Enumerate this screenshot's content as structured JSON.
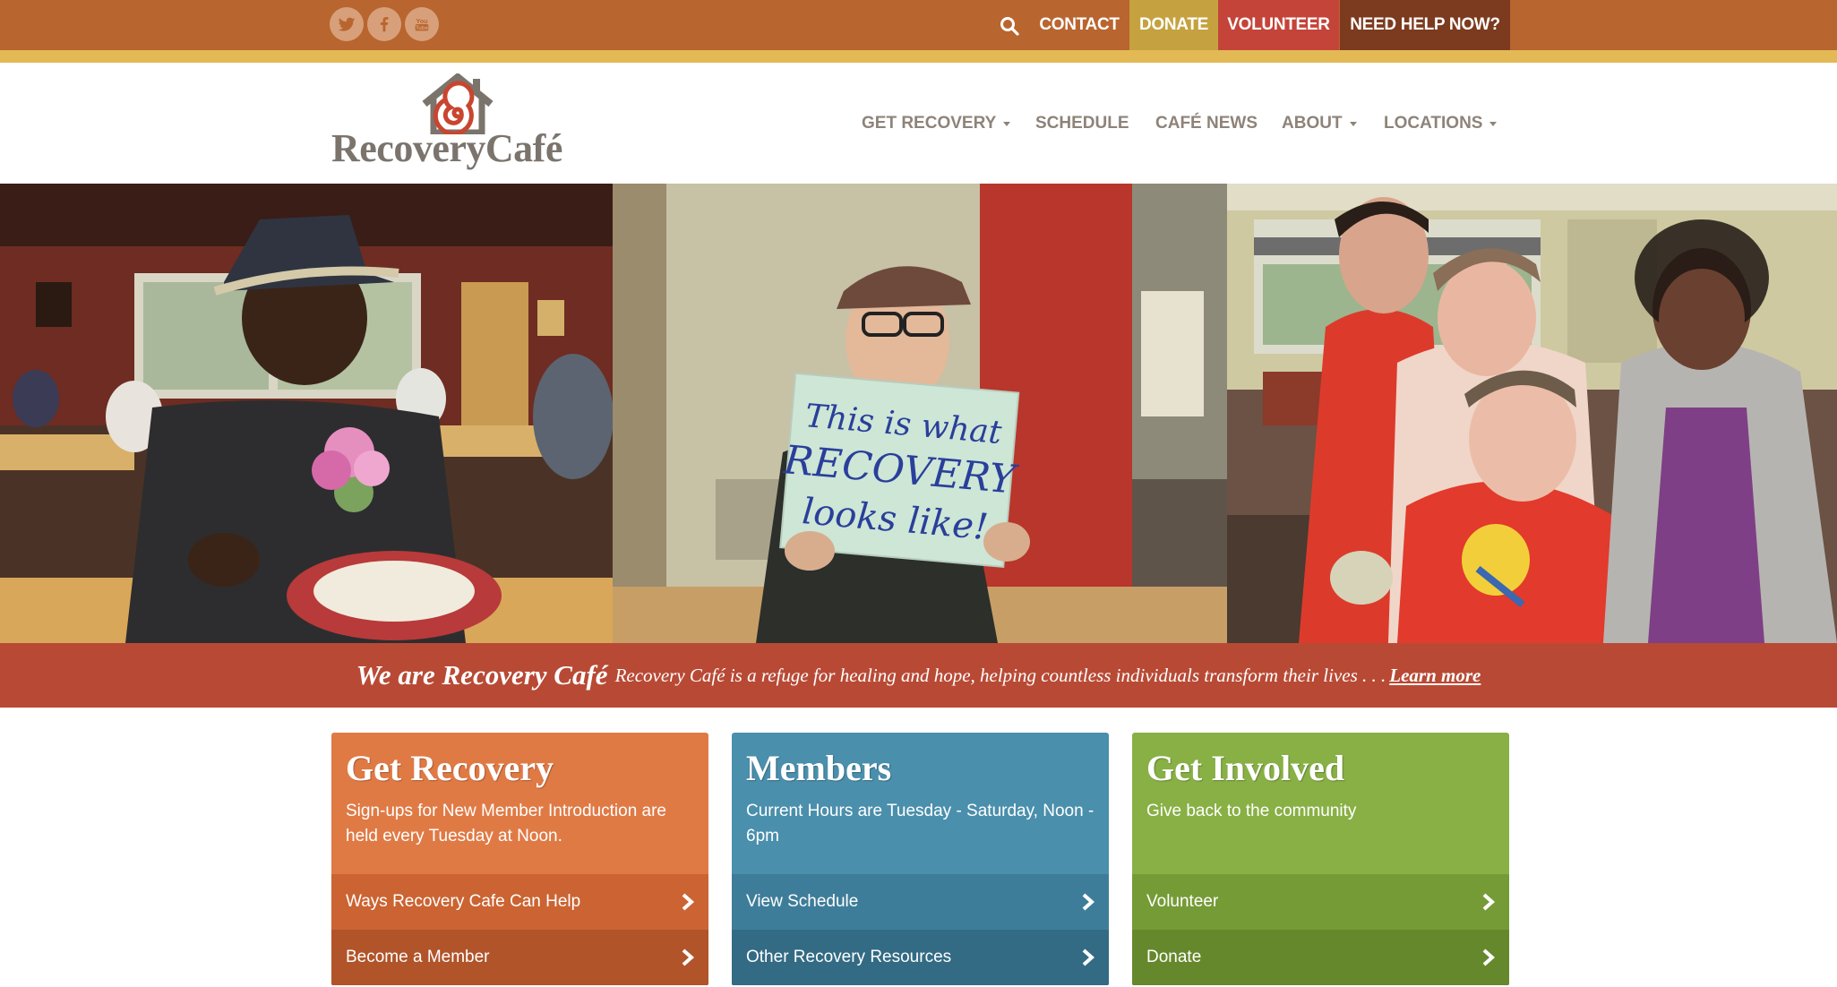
{
  "topbar": {
    "social": [
      "twitter-icon",
      "facebook-icon",
      "youtube-icon"
    ],
    "search_icon": "search-icon",
    "contact": "CONTACT",
    "donate": "DONATE",
    "volunteer": "VOLUNTEER",
    "need_help": "NEED HELP NOW?"
  },
  "logo": {
    "text": "RecoveryCafé"
  },
  "nav": {
    "items": [
      {
        "label": "GET RECOVERY",
        "has_dropdown": true
      },
      {
        "label": "SCHEDULE",
        "has_dropdown": false
      },
      {
        "label": "CAFÉ NEWS",
        "has_dropdown": false
      },
      {
        "label": "ABOUT",
        "has_dropdown": true
      },
      {
        "label": "LOCATIONS",
        "has_dropdown": true
      }
    ]
  },
  "hero": {
    "sign_text": [
      "This is what",
      "RECOVERY",
      "looks like!"
    ]
  },
  "banner": {
    "title": "We are Recovery Café",
    "text": "Recovery Café is a refuge for healing and hope, helping countless individuals transform their lives . . .",
    "link": "Learn more"
  },
  "cards": [
    {
      "title": "Get Recovery",
      "subtitle": "Sign-ups for New Member Introduction are held every Tuesday at Noon.",
      "links": [
        "Ways Recovery Cafe Can Help",
        "Become a Member"
      ],
      "color": "#e07a45"
    },
    {
      "title": "Members",
      "subtitle": "Current Hours are Tuesday - Saturday, Noon - 6pm",
      "links": [
        "View Schedule",
        "Other Recovery Resources"
      ],
      "color": "#4a8fac"
    },
    {
      "title": "Get Involved",
      "subtitle": "Give back to the community",
      "links": [
        "Volunteer",
        "Donate"
      ],
      "color": "#88b045"
    }
  ],
  "colors": {
    "topbar": "#b9652f",
    "gold": "#e2b955",
    "banner": "#b84a35"
  }
}
